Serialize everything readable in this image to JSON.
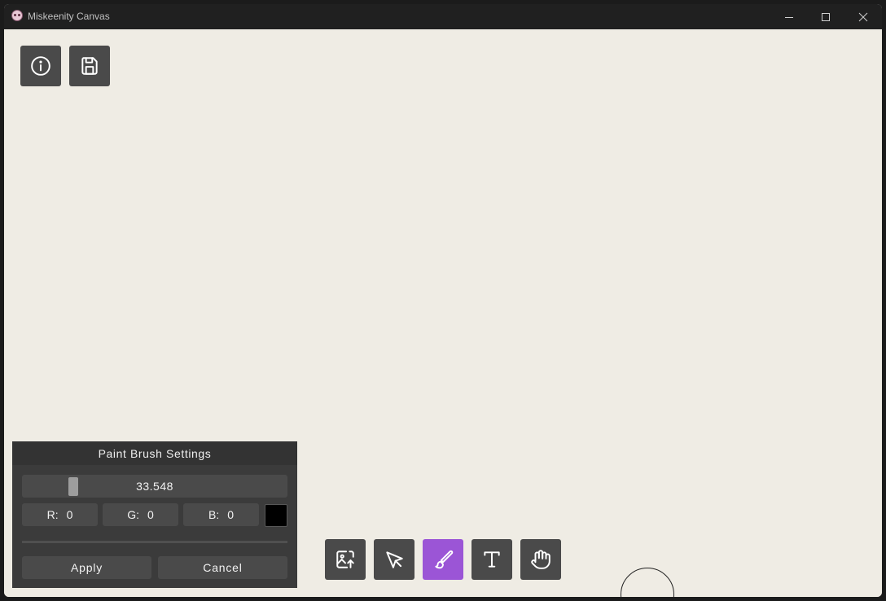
{
  "window": {
    "title": "Miskeenity Canvas"
  },
  "top_toolbar": {
    "buttons": [
      {
        "icon": "info-icon"
      },
      {
        "icon": "save-icon"
      }
    ]
  },
  "brush_panel": {
    "title": "Paint Brush Settings",
    "size_value": "33.548",
    "size_fraction": 0.18,
    "r_label": "R:",
    "r_value": "0",
    "g_label": "G:",
    "g_value": "0",
    "b_label": "B:",
    "b_value": "0",
    "color_preview": "#000000",
    "apply_label": "Apply",
    "cancel_label": "Cancel"
  },
  "bottom_toolbar": {
    "tools": [
      {
        "icon": "image-upload-icon"
      },
      {
        "icon": "select-cursor-icon"
      },
      {
        "icon": "paint-brush-icon",
        "active": true
      },
      {
        "icon": "text-icon"
      },
      {
        "icon": "hand-pan-icon"
      }
    ],
    "active_color": "#9b55d6"
  }
}
